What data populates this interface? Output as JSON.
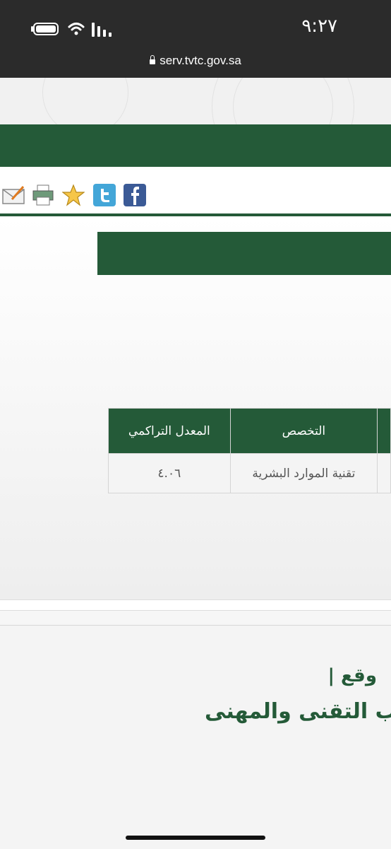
{
  "status_bar": {
    "time": "٩:٢٧",
    "url": "serv.tvtc.gov.sa"
  },
  "toolbar": {
    "icons": [
      "email-icon",
      "print-icon",
      "favorite-star-icon",
      "twitter-icon",
      "facebook-icon"
    ]
  },
  "table": {
    "headers": [
      "",
      "التخصص",
      "المعدل التراكمي"
    ],
    "row": {
      "specialization": "تقنية الموارد البشرية",
      "gpa": "٤.٠٦"
    }
  },
  "footer": {
    "line1": "وقع |",
    "line2": "ب التقنى والمهنى"
  },
  "colors": {
    "brand_green": "#245a38",
    "status_bar": "#2b2b2b"
  }
}
